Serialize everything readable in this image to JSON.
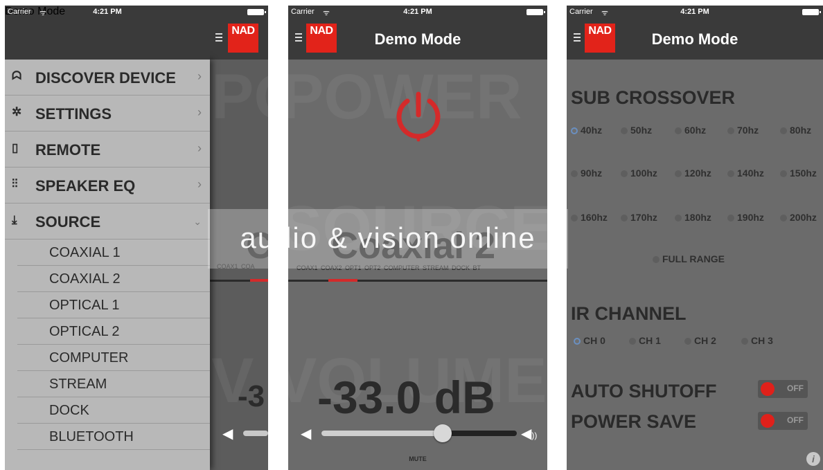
{
  "status": {
    "carrier": "Carrier",
    "wifi": "wifi-icon",
    "time": "4:21 PM"
  },
  "header": {
    "title": "Demo Mode",
    "logo": "NAD"
  },
  "menu": {
    "items": [
      {
        "icon": "binoculars-icon",
        "label": "DISCOVER DEVICE"
      },
      {
        "icon": "gear-icon",
        "label": "SETTINGS"
      },
      {
        "icon": "remote-icon",
        "label": "REMOTE"
      },
      {
        "icon": "equalizer-icon",
        "label": "SPEAKER EQ"
      },
      {
        "icon": "download-icon",
        "label": "SOURCE"
      }
    ],
    "source_items": [
      "COAXIAL 1",
      "COAXIAL 2",
      "OPTICAL 1",
      "OPTICAL 2",
      "COMPUTER",
      "STREAM",
      "DOCK",
      "BLUETOOTH"
    ]
  },
  "main": {
    "source_current": "Coaxial 2",
    "source_partial": "C",
    "tabs_text": "COAX1  COAX2  OPT1  OPT2  COMPUTER  STREAM  DOCK  BT",
    "tabs_partial": "COAX1  COA",
    "volume": "-33.0 dB",
    "volume_partial": "-3",
    "volume_level": 0.62,
    "mute_label": "MUTE",
    "ghost_power": "POWER",
    "ghost_power_partial": "PO",
    "ghost_source": "SOURCE",
    "ghost_volume": "VOLUME",
    "ghost_volume_partial": "V"
  },
  "settings": {
    "sub_crossover_title": "SUB CROSSOVER",
    "crossover_rows": [
      [
        "40hz",
        "50hz",
        "60hz",
        "70hz",
        "80hz"
      ],
      [
        "90hz",
        "100hz",
        "120hz",
        "140hz",
        "150hz"
      ],
      [
        "160hz",
        "170hz",
        "180hz",
        "190hz",
        "200hz"
      ]
    ],
    "crossover_selected": "40hz",
    "full_range": "FULL RANGE",
    "ir_channel_title": "IR CHANNEL",
    "ir_channels": [
      "CH 0",
      "CH 1",
      "CH 2",
      "CH 3"
    ],
    "ir_selected": "CH 0",
    "auto_shutoff": "AUTO SHUTOFF",
    "power_save": "POWER SAVE",
    "toggle_off": "OFF"
  },
  "watermark": "audio & vision online",
  "colors": {
    "accent": "#e2231a",
    "panel": "#6b6b6b",
    "bar": "#3a3a3a"
  }
}
